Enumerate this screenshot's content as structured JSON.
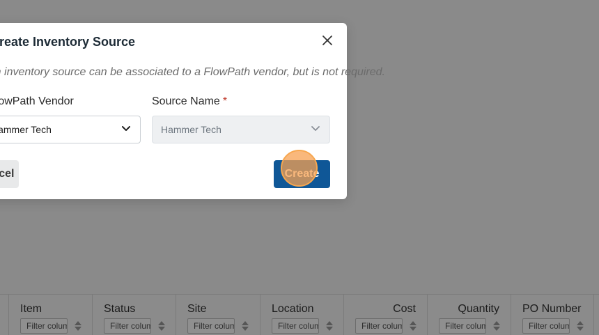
{
  "modal": {
    "title": "Create Inventory Source",
    "description": "An inventory source can be associated to a FlowPath vendor, but is not required.",
    "vendor_label": "FlowPath Vendor",
    "vendor_value": "Hammer Tech",
    "source_label": "Source Name",
    "required_mark": "*",
    "source_value": "Hammer Tech",
    "cancel_label": "Cancel",
    "create_label": "Create",
    "icons": {
      "close": "close-icon",
      "vendor_chevron": "chevron-down-icon",
      "source_chevron": "chevron-down-icon"
    }
  },
  "table": {
    "columns": [
      {
        "title": "Item",
        "filter_placeholder": "Filter column"
      },
      {
        "title": "Status",
        "filter_placeholder": "Filter column"
      },
      {
        "title": "Site",
        "filter_placeholder": "Filter column"
      },
      {
        "title": "Location",
        "filter_placeholder": "Filter column"
      },
      {
        "title": "Cost",
        "filter_placeholder": "Filter column"
      },
      {
        "title": "Quantity",
        "filter_placeholder": "Filter column"
      },
      {
        "title": "PO Number",
        "filter_placeholder": "Filter column"
      }
    ]
  },
  "colors": {
    "overlay": "#8a8a8a",
    "primary_button": "#0f5797",
    "required": "#c0392b",
    "click_marker": "#f7a74f"
  }
}
